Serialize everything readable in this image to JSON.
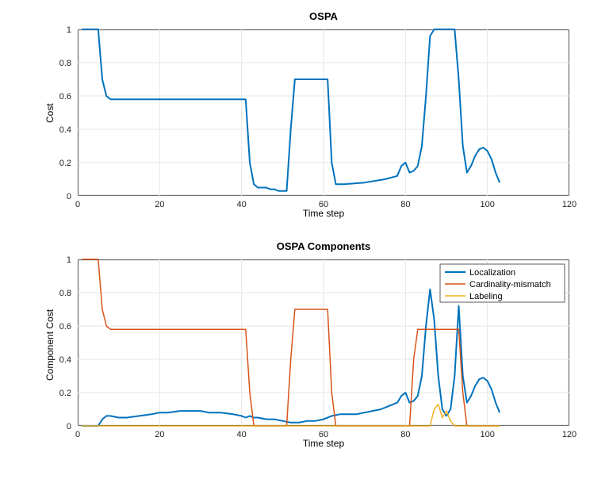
{
  "chart_data": [
    {
      "type": "line",
      "title": "OSPA",
      "xlabel": "Time step",
      "ylabel": "Cost",
      "xlim": [
        0,
        120
      ],
      "ylim": [
        0,
        1
      ],
      "xticks": [
        0,
        20,
        40,
        60,
        80,
        100,
        120
      ],
      "yticks": [
        0,
        0.2,
        0.4,
        0.6,
        0.8,
        1
      ],
      "series": [
        {
          "name": "Cost",
          "color": "#0072BD",
          "x": [
            1,
            2,
            3,
            4,
            5,
            6,
            7,
            8,
            10,
            15,
            20,
            25,
            30,
            35,
            40,
            41,
            42,
            43,
            44,
            45,
            46,
            47,
            48,
            49,
            50,
            51,
            52,
            53,
            54,
            55,
            56,
            57,
            58,
            59,
            60,
            61,
            62,
            63,
            64,
            65,
            70,
            75,
            78,
            79,
            80,
            81,
            82,
            83,
            84,
            85,
            86,
            87,
            88,
            89,
            90,
            91,
            92,
            93,
            94,
            95,
            96,
            97,
            98,
            99,
            100,
            101,
            102,
            103
          ],
          "values": [
            1.0,
            1.0,
            1.0,
            1.0,
            1.0,
            0.7,
            0.6,
            0.58,
            0.58,
            0.58,
            0.58,
            0.58,
            0.58,
            0.58,
            0.58,
            0.58,
            0.2,
            0.07,
            0.05,
            0.05,
            0.05,
            0.04,
            0.04,
            0.03,
            0.03,
            0.03,
            0.4,
            0.7,
            0.7,
            0.7,
            0.7,
            0.7,
            0.7,
            0.7,
            0.7,
            0.7,
            0.2,
            0.07,
            0.07,
            0.07,
            0.08,
            0.1,
            0.12,
            0.18,
            0.2,
            0.14,
            0.15,
            0.18,
            0.3,
            0.6,
            0.96,
            1.0,
            1.0,
            1.0,
            1.0,
            1.0,
            1.0,
            0.7,
            0.3,
            0.14,
            0.18,
            0.24,
            0.28,
            0.29,
            0.27,
            0.22,
            0.14,
            0.08
          ]
        }
      ]
    },
    {
      "type": "line",
      "title": "OSPA Components",
      "xlabel": "Time step",
      "ylabel": "Component Cost",
      "xlim": [
        0,
        120
      ],
      "ylim": [
        0,
        1
      ],
      "xticks": [
        0,
        20,
        40,
        60,
        80,
        100,
        120
      ],
      "yticks": [
        0,
        0.2,
        0.4,
        0.6,
        0.8,
        1
      ],
      "legend": {
        "entries": [
          "Localization",
          "Cardinality-mismatch",
          "Labeling"
        ],
        "position": "upper-right-inside"
      },
      "series": [
        {
          "name": "Localization",
          "color": "#0072BD",
          "x": [
            1,
            3,
            5,
            6,
            7,
            8,
            10,
            12,
            15,
            18,
            20,
            22,
            25,
            28,
            30,
            32,
            35,
            38,
            40,
            41,
            42,
            43,
            44,
            46,
            48,
            50,
            52,
            54,
            56,
            58,
            60,
            62,
            64,
            66,
            68,
            70,
            72,
            74,
            76,
            78,
            79,
            80,
            81,
            82,
            83,
            84,
            85,
            86,
            87,
            88,
            89,
            90,
            91,
            92,
            93,
            94,
            95,
            96,
            97,
            98,
            99,
            100,
            101,
            102,
            103
          ],
          "values": [
            0.0,
            0.0,
            0.0,
            0.04,
            0.06,
            0.06,
            0.05,
            0.05,
            0.06,
            0.07,
            0.08,
            0.08,
            0.09,
            0.09,
            0.09,
            0.08,
            0.08,
            0.07,
            0.06,
            0.05,
            0.06,
            0.05,
            0.05,
            0.04,
            0.04,
            0.03,
            0.02,
            0.02,
            0.03,
            0.03,
            0.04,
            0.06,
            0.07,
            0.07,
            0.07,
            0.08,
            0.09,
            0.1,
            0.12,
            0.14,
            0.18,
            0.2,
            0.14,
            0.15,
            0.18,
            0.3,
            0.6,
            0.82,
            0.64,
            0.3,
            0.1,
            0.06,
            0.1,
            0.3,
            0.72,
            0.3,
            0.14,
            0.18,
            0.24,
            0.28,
            0.29,
            0.27,
            0.22,
            0.14,
            0.08
          ]
        },
        {
          "name": "Cardinality-mismatch",
          "color": "#D95319",
          "x": [
            1,
            2,
            3,
            4,
            5,
            6,
            7,
            8,
            10,
            15,
            20,
            25,
            30,
            35,
            40,
            41,
            42,
            43,
            44,
            46,
            48,
            50,
            51,
            52,
            53,
            55,
            58,
            60,
            61,
            62,
            63,
            65,
            70,
            75,
            78,
            80,
            81,
            82,
            83,
            85,
            88,
            90,
            92,
            93,
            94,
            95,
            96,
            100,
            103
          ],
          "values": [
            1.0,
            1.0,
            1.0,
            1.0,
            1.0,
            0.7,
            0.6,
            0.58,
            0.58,
            0.58,
            0.58,
            0.58,
            0.58,
            0.58,
            0.58,
            0.58,
            0.2,
            0.0,
            0.0,
            0.0,
            0.0,
            0.0,
            0.0,
            0.4,
            0.7,
            0.7,
            0.7,
            0.7,
            0.7,
            0.2,
            0.0,
            0.0,
            0.0,
            0.0,
            0.0,
            0.0,
            0.0,
            0.4,
            0.58,
            0.58,
            0.58,
            0.58,
            0.58,
            0.58,
            0.2,
            0.0,
            0.0,
            0.0,
            0.0
          ]
        },
        {
          "name": "Labeling",
          "color": "#EDB120",
          "x": [
            1,
            20,
            40,
            60,
            80,
            85,
            86,
            87,
            88,
            89,
            90,
            91,
            92,
            100,
            103
          ],
          "values": [
            0.0,
            0.0,
            0.0,
            0.0,
            0.0,
            0.0,
            0.0,
            0.1,
            0.13,
            0.05,
            0.09,
            0.03,
            0.0,
            0.0,
            0.0
          ]
        }
      ]
    }
  ]
}
